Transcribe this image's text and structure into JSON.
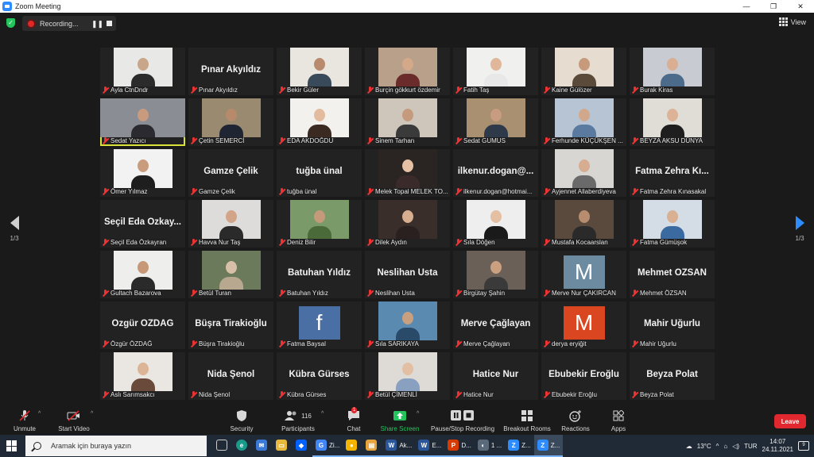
{
  "window": {
    "title": "Zoom Meeting",
    "controls": [
      "—",
      "❐",
      "✕"
    ]
  },
  "recording": {
    "status": "Recording..."
  },
  "view": {
    "label": "View"
  },
  "pager": {
    "left": "1/3",
    "right": "1/3"
  },
  "participants_grid": [
    {
      "name": "Ayla CtnDndr",
      "display": "video",
      "skin": "#c9a58a",
      "cloth": "#2b2b2b",
      "bg": "#e8e8e6"
    },
    {
      "name": "Pınar Akyıldız",
      "display": "name",
      "big": "Pınar Akyıldız"
    },
    {
      "name": "Bekir Güler",
      "display": "video",
      "skin": "#b88a6e",
      "cloth": "#394a5a",
      "bg": "#e9e6e0"
    },
    {
      "name": "Burçin gökkurt özdemir",
      "display": "video",
      "skin": "#d4a98a",
      "cloth": "#6b2b2b",
      "bg": "#b8a08a"
    },
    {
      "name": "Fatih Taş",
      "display": "video",
      "skin": "#e0b79a",
      "cloth": "#e8e8e8",
      "bg": "#f0f0ee"
    },
    {
      "name": "Kaine Gülözer",
      "display": "video",
      "skin": "#c79a7c",
      "cloth": "#5a4a3a",
      "bg": "#e6dccf"
    },
    {
      "name": "Burak Kiras",
      "display": "video",
      "skin": "#d9ae92",
      "cloth": "#4c6a8a",
      "bg": "#c8ccd2"
    },
    {
      "name": "Sedat Yazıcı",
      "display": "video",
      "skin": "#c89a7e",
      "cloth": "#2a2a30",
      "bg": "#8a8e94",
      "active": true
    },
    {
      "name": "Çetin SEMERCİ",
      "display": "video",
      "skin": "#b78a6c",
      "cloth": "#1f2533",
      "bg": "#9a8a70"
    },
    {
      "name": "EDA AKDOĞDU",
      "display": "video",
      "skin": "#e3bca0",
      "cloth": "#3a2a22",
      "bg": "#f3f1ee"
    },
    {
      "name": "Sinem Tarhan",
      "display": "video",
      "skin": "#c69a7c",
      "cloth": "#3a3a3a",
      "bg": "#cfc6bb"
    },
    {
      "name": "Sedat GUMUS",
      "display": "video",
      "skin": "#c89c80",
      "cloth": "#2e3a4a",
      "bg": "#a89070"
    },
    {
      "name": "Ferhunde KÜÇÜKŞEN ...",
      "display": "video",
      "skin": "#d2a88c",
      "cloth": "#5a7aa0",
      "bg": "#b6c4d4"
    },
    {
      "name": "BEYZA AKSU DÜNYA",
      "display": "video",
      "skin": "#dcb396",
      "cloth": "#1e1e1e",
      "bg": "#e0dcd6"
    },
    {
      "name": "Ömer Yılmaz",
      "display": "video",
      "skin": "#c99c7e",
      "cloth": "#1e1e1e",
      "bg": "#f2f2f2"
    },
    {
      "name": "Gamze Çelik",
      "display": "name",
      "big": "Gamze Çelik"
    },
    {
      "name": "tuğba ünal",
      "display": "name",
      "big": "tuğba ünal"
    },
    {
      "name": "Melek Topal MELEK TO...",
      "display": "video",
      "skin": "#e6c0a4",
      "cloth": "#3a2a2a",
      "bg": "#2a2422"
    },
    {
      "name": "ilkenur.dogan@hotmai...",
      "display": "name",
      "big": "ilkenur.dogan@..."
    },
    {
      "name": "Ayjennet Allaberdiyeva",
      "display": "video",
      "skin": "#d6ad90",
      "cloth": "#6a6a6a",
      "bg": "#d8d6d2"
    },
    {
      "name": "Fatma Zehra Kınasakal",
      "display": "name",
      "big": "Fatma Zehra Kı..."
    },
    {
      "name": "Seçil Eda Özkayran",
      "display": "name",
      "big": "Seçil Eda Özkay..."
    },
    {
      "name": "Havva Nur Taş",
      "display": "video",
      "skin": "#d2a488",
      "cloth": "#2a2a2a",
      "bg": "#dedcda"
    },
    {
      "name": "Deniz Bilir",
      "display": "video",
      "skin": "#c49a7a",
      "cloth": "#4a6a3a",
      "bg": "#7a9a6a"
    },
    {
      "name": "Dilek Aydın",
      "display": "video",
      "skin": "#d8ae90",
      "cloth": "#2a2020",
      "bg": "#3a2e2a"
    },
    {
      "name": "Sıla Döğen",
      "display": "video",
      "skin": "#e4bfa2",
      "cloth": "#1a1a1a",
      "bg": "#eeeeee"
    },
    {
      "name": "Mustafa Kocaarslan",
      "display": "video",
      "skin": "#b88c6e",
      "cloth": "#2a2a2a",
      "bg": "#5a4a3e"
    },
    {
      "name": "Fatma Gümüşok",
      "display": "video",
      "skin": "#d9b092",
      "cloth": "#3a6aa0",
      "bg": "#d4dce6"
    },
    {
      "name": "Gultach Bazarova",
      "display": "video",
      "skin": "#c69876",
      "cloth": "#2a2a2a",
      "bg": "#eeeeec"
    },
    {
      "name": "Betül Turan",
      "display": "video",
      "skin": "#d8c0a8",
      "cloth": "#b8a890",
      "bg": "#6a7a5a"
    },
    {
      "name": "Batuhan Yıldız",
      "display": "name",
      "big": "Batuhan Yıldız"
    },
    {
      "name": "Neslihan Usta",
      "display": "name",
      "big": "Neslihan Usta"
    },
    {
      "name": "Birgütay Şahin",
      "display": "video",
      "skin": "#caa080",
      "cloth": "#3a3a3a",
      "bg": "#6a6058"
    },
    {
      "name": "Merve Nur ÇAKIRCAN",
      "display": "avatar",
      "letter": "M",
      "avatar_color": "#6d8ba0"
    },
    {
      "name": "Mehmet ÖZSAN",
      "display": "name",
      "big": "Mehmet ÖZSAN"
    },
    {
      "name": "Özgür ÖZDAĞ",
      "display": "name",
      "big": "Özgür ÖZDAĞ"
    },
    {
      "name": "Büşra Tirakioğlu",
      "display": "name",
      "big": "Büşra Tirakioğlu"
    },
    {
      "name": "Fatma Baysal",
      "display": "avatar",
      "letter": "f",
      "avatar_color": "#4a6fa5"
    },
    {
      "name": "Sıla SARIKAYA",
      "display": "video",
      "skin": "#c8a080",
      "cloth": "#2a4a6a",
      "bg": "#5a8ab0"
    },
    {
      "name": "Merve Çağlayan",
      "display": "name",
      "big": "Merve Çağlayan"
    },
    {
      "name": "derya eryiğit",
      "display": "avatar",
      "letter": "M",
      "avatar_color": "#d9461f"
    },
    {
      "name": "Mahir Uğurlu",
      "display": "name",
      "big": "Mahir Uğurlu"
    },
    {
      "name": "Aslı Sarımsakcı",
      "display": "video",
      "skin": "#dcb496",
      "cloth": "#6a4a3a",
      "bg": "#eae6e2"
    },
    {
      "name": "Nida Şenol",
      "display": "name",
      "big": "Nida Şenol"
    },
    {
      "name": "Kübra Gürses",
      "display": "name",
      "big": "Kübra Gürses"
    },
    {
      "name": "Betül ÇİMENLİ",
      "display": "video",
      "skin": "#e2bea2",
      "cloth": "#8aa0c0",
      "bg": "#dedad6"
    },
    {
      "name": "Hatice Nur",
      "display": "name",
      "big": "Hatice Nur"
    },
    {
      "name": "Ebubekir Eroğlu",
      "display": "name",
      "big": "Ebubekir Eroğlu"
    },
    {
      "name": "Beyza Polat",
      "display": "name",
      "big": "Beyza Polat"
    }
  ],
  "toolbar": {
    "unmute": "Unmute",
    "start_video": "Start Video",
    "security": "Security",
    "participants": "Participants",
    "participants_count": "116",
    "chat": "Chat",
    "chat_badge": "1",
    "share_screen": "Share Screen",
    "pause_stop_recording": "Pause/Stop Recording",
    "breakout_rooms": "Breakout Rooms",
    "reactions": "Reactions",
    "apps": "Apps",
    "leave": "Leave",
    "share_color": "#23c45d",
    "leave_color": "#e0282e"
  },
  "taskbar": {
    "search_placeholder": "Aramak için buraya yazın",
    "apps": [
      {
        "label": "Zi...",
        "color": "#4285f4",
        "glyph": "G"
      },
      {
        "label": "",
        "color": "#f4b400",
        "glyph": "●"
      },
      {
        "label": "",
        "color": "#e8a33c",
        "glyph": "▤"
      },
      {
        "label": "Ak...",
        "color": "#2b579a",
        "glyph": "W"
      },
      {
        "label": "E...",
        "color": "#2b579a",
        "glyph": "W"
      },
      {
        "label": "D...",
        "color": "#d83b01",
        "glyph": "P"
      },
      {
        "label": "1 ...",
        "color": "#5a6a7a",
        "glyph": "◐"
      },
      {
        "label": "Z...",
        "color": "#2d8cff",
        "glyph": "Z"
      },
      {
        "label": "Z...",
        "color": "#2d8cff",
        "glyph": "Z"
      }
    ],
    "weather": "13°C",
    "language": "TUR",
    "time": "14:07",
    "date": "24.11.2021",
    "notifications": "9"
  }
}
